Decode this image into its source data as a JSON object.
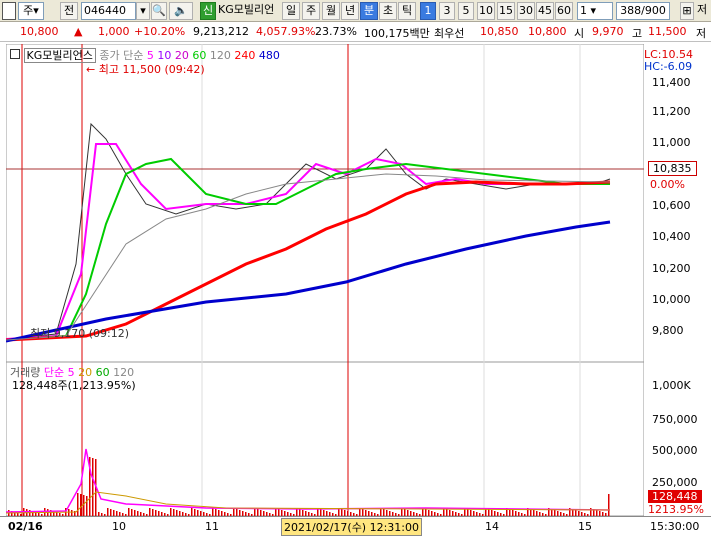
{
  "toolbar": {
    "type_label": "주",
    "prev_label": "전",
    "code": "046440",
    "badge": "신",
    "stock_name": "KG모빌리언",
    "periods": [
      "일",
      "주",
      "월",
      "년",
      "분",
      "초",
      "틱"
    ],
    "active_period": "분",
    "intervals": [
      "1",
      "3",
      "5",
      "10",
      "15",
      "30",
      "45",
      "60"
    ],
    "active_interval": "1",
    "multiplier": "1",
    "count": "388",
    "count_total": "/900",
    "save_label": "저"
  },
  "quote": {
    "price": "10,800",
    "change": "1,000",
    "change_pct": "+10.20%",
    "volume": "9,213,212",
    "vol_ratio": "4,057.93%",
    "turnover": "23.73%",
    "amount": "100,175백만",
    "best_label": "최우선",
    "best_value": "10,850",
    "open_label": "10,800",
    "open_prefix": "시",
    "open_value": "9,970",
    "high_label": "고",
    "high_value": "11,500",
    "low_label": "저"
  },
  "price_panel": {
    "stock_label": "KG모빌리언스",
    "ma_label": "종가 단순",
    "ma_periods": [
      "5",
      "10",
      "20",
      "60",
      "120",
      "240",
      "480"
    ],
    "ma_colors": [
      "#ff00ff",
      "#9900ff",
      "#cc00cc",
      "#00cc00",
      "#888888",
      "#ff0000",
      "#0000cc"
    ],
    "high_marker": "최고 11,500 (09:42)",
    "low_marker": "최저 9,170 (09:12)",
    "lc": "LC:10.54",
    "hc": "HC:-6.09",
    "current_price": "10,835",
    "current_pct": "0.00%",
    "y_ticks": [
      "11,400",
      "11,200",
      "11,000",
      "10,800",
      "10,600",
      "10,400",
      "10,200",
      "10,000",
      "9,800"
    ]
  },
  "volume_panel": {
    "label": "거래량",
    "ma_label": "단순",
    "ma_periods": [
      "5",
      "20",
      "60",
      "120"
    ],
    "ma_colors": [
      "#ff00ff",
      "#cc9900",
      "#00aa00",
      "#888888"
    ],
    "value": "128,448주(1,213.95%)",
    "y_ticks": [
      "1,000K",
      "750,000",
      "500,000",
      "250,000"
    ],
    "current": "128,448",
    "current_pct": "1213.95%"
  },
  "x_axis": {
    "labels": [
      "02/16",
      "10",
      "11",
      "2021/02/17(수) 12:31:00",
      "14",
      "15"
    ],
    "time": "15:30:00"
  }
}
